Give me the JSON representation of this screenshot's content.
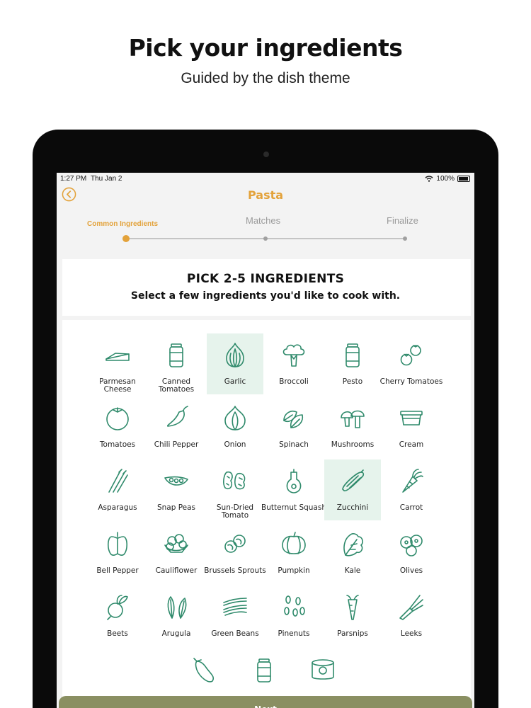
{
  "promo": {
    "title": "Pick your ingredients",
    "subtitle": "Guided by the dish theme"
  },
  "status_bar": {
    "time": "1:27 PM",
    "date": "Thu Jan 2",
    "battery": "100%"
  },
  "nav": {
    "title": "Pasta",
    "back_icon": "chevron-left-circle-icon"
  },
  "steps": [
    {
      "label": "Common Ingredients",
      "active": true
    },
    {
      "label": "Matches",
      "active": false
    },
    {
      "label": "Finalize",
      "active": false
    }
  ],
  "header": {
    "title": "PICK 2-5 INGREDIENTS",
    "subtitle": "Select a few ingredients you'd like to cook with."
  },
  "ingredients": [
    {
      "label": "Parmesan Cheese",
      "icon": "cheese-wedge-icon",
      "selected": false
    },
    {
      "label": "Canned Tomatoes",
      "icon": "jar-icon",
      "selected": false
    },
    {
      "label": "Garlic",
      "icon": "garlic-icon",
      "selected": true
    },
    {
      "label": "Broccoli",
      "icon": "broccoli-icon",
      "selected": false
    },
    {
      "label": "Pesto",
      "icon": "jar-icon",
      "selected": false
    },
    {
      "label": "Cherry Tomatoes",
      "icon": "cherry-tomatoes-icon",
      "selected": false
    },
    {
      "label": "Tomatoes",
      "icon": "tomato-icon",
      "selected": false
    },
    {
      "label": "Chili Pepper",
      "icon": "chili-pepper-icon",
      "selected": false
    },
    {
      "label": "Onion",
      "icon": "onion-icon",
      "selected": false
    },
    {
      "label": "Spinach",
      "icon": "spinach-icon",
      "selected": false
    },
    {
      "label": "Mushrooms",
      "icon": "mushroom-icon",
      "selected": false
    },
    {
      "label": "Cream",
      "icon": "cream-tub-icon",
      "selected": false
    },
    {
      "label": "Asparagus",
      "icon": "asparagus-icon",
      "selected": false
    },
    {
      "label": "Snap Peas",
      "icon": "pea-pod-icon",
      "selected": false
    },
    {
      "label": "Sun-Dried Tomato",
      "icon": "sun-dried-tomato-icon",
      "selected": false
    },
    {
      "label": "Butternut Squash",
      "icon": "squash-icon",
      "selected": false
    },
    {
      "label": "Zucchini",
      "icon": "zucchini-icon",
      "selected": true
    },
    {
      "label": "Carrot",
      "icon": "carrot-icon",
      "selected": false
    },
    {
      "label": "Bell Pepper",
      "icon": "bell-pepper-icon",
      "selected": false
    },
    {
      "label": "Cauliflower",
      "icon": "cauliflower-icon",
      "selected": false
    },
    {
      "label": "Brussels Sprouts",
      "icon": "brussels-sprouts-icon",
      "selected": false
    },
    {
      "label": "Pumpkin",
      "icon": "pumpkin-icon",
      "selected": false
    },
    {
      "label": "Kale",
      "icon": "kale-icon",
      "selected": false
    },
    {
      "label": "Olives",
      "icon": "olives-icon",
      "selected": false
    },
    {
      "label": "Beets",
      "icon": "beet-icon",
      "selected": false
    },
    {
      "label": "Arugula",
      "icon": "arugula-icon",
      "selected": false
    },
    {
      "label": "Green Beans",
      "icon": "green-beans-icon",
      "selected": false
    },
    {
      "label": "Pinenuts",
      "icon": "pine-nuts-icon",
      "selected": false
    },
    {
      "label": "Parsnips",
      "icon": "parsnip-icon",
      "selected": false
    },
    {
      "label": "Leeks",
      "icon": "leek-icon",
      "selected": false
    },
    {
      "label": "",
      "icon": "eggplant-icon",
      "selected": false
    },
    {
      "label": "",
      "icon": "jar-icon",
      "selected": false
    },
    {
      "label": "",
      "icon": "can-icon",
      "selected": false
    }
  ],
  "next_button": "Next",
  "colors": {
    "accent": "#e3a23a",
    "icon": "#2f8a6b",
    "selected_bg": "#e6f3ec",
    "button": "#8a8f62"
  }
}
